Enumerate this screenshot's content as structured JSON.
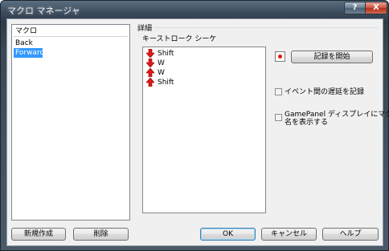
{
  "window": {
    "title": "マクロ マネージャ"
  },
  "titlebar": {
    "help_glyph": "?",
    "close_glyph": "X"
  },
  "macro_list": {
    "header": "マクロ",
    "items": [
      {
        "label": "Back",
        "selected": false
      },
      {
        "label": "Forward",
        "selected": true
      }
    ]
  },
  "details": {
    "group_label": "詳細",
    "sequence_label": "キーストローク シーケ",
    "keystrokes": [
      {
        "direction": "down",
        "key": "Shift",
        "icon": "arrow-down-icon"
      },
      {
        "direction": "down",
        "key": "W",
        "icon": "arrow-down-icon"
      },
      {
        "direction": "up",
        "key": "W",
        "icon": "arrow-up-icon"
      },
      {
        "direction": "up",
        "key": "Shift",
        "icon": "arrow-up-icon"
      }
    ],
    "record_button": "記録を開始",
    "record_delays_checkbox": {
      "label": "イベント間の遅延を記録",
      "checked": false
    },
    "display_name_checkbox": {
      "line1": "GamePanel ディスプレイにマクロ",
      "line2": "名を表示する",
      "checked": false
    }
  },
  "buttons": {
    "new": "新規作成",
    "delete": "削除",
    "ok": "OK",
    "cancel": "キャンセル",
    "help": "ヘルプ"
  },
  "colors": {
    "selection": "#3399ff",
    "arrow_red": "#e01818",
    "record_dot": "#e21010"
  }
}
